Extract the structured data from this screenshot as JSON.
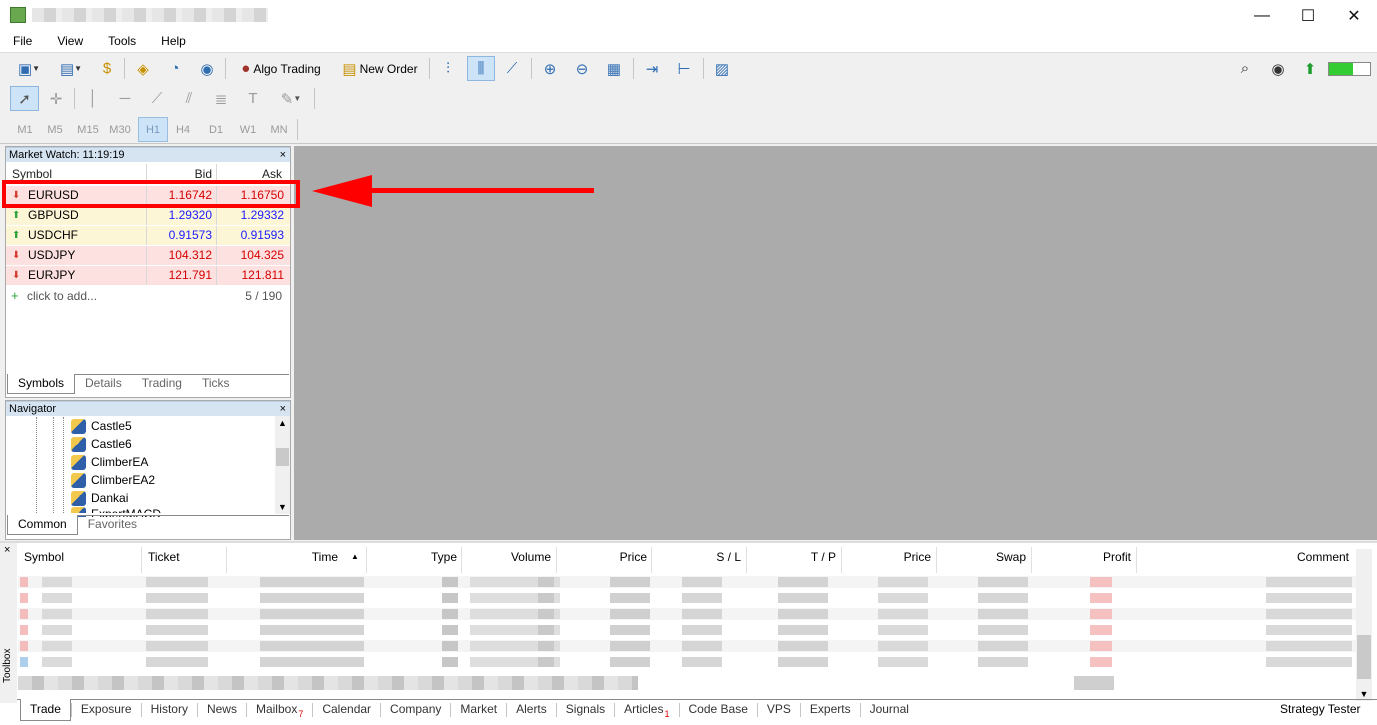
{
  "window": {
    "minimize_glyph": "—",
    "maximize_glyph": "☐",
    "close_glyph": "✕"
  },
  "menu": [
    "File",
    "View",
    "Tools",
    "Help"
  ],
  "toolbar": {
    "algo_trading": "Algo Trading",
    "new_order": "New Order"
  },
  "timeframes": [
    "M1",
    "M5",
    "M15",
    "M30",
    "H1",
    "H4",
    "D1",
    "W1",
    "MN"
  ],
  "selected_timeframe": "H1",
  "market_watch": {
    "title": "Market Watch: 11:19:19",
    "close": "×",
    "columns": {
      "symbol": "Symbol",
      "bid": "Bid",
      "ask": "Ask"
    },
    "rows": [
      {
        "symbol": "EURUSD",
        "bid": "1.16742",
        "ask": "1.16750",
        "direction": "down"
      },
      {
        "symbol": "GBPUSD",
        "bid": "1.29320",
        "ask": "1.29332",
        "direction": "up"
      },
      {
        "symbol": "USDCHF",
        "bid": "0.91573",
        "ask": "0.91593",
        "direction": "up"
      },
      {
        "symbol": "USDJPY",
        "bid": "104.312",
        "ask": "104.325",
        "direction": "down"
      },
      {
        "symbol": "EURJPY",
        "bid": "121.791",
        "ask": "121.811",
        "direction": "down"
      }
    ],
    "add_text": "click to add...",
    "count": "5 / 190",
    "tabs": [
      "Symbols",
      "Details",
      "Trading",
      "Ticks"
    ]
  },
  "navigator": {
    "title": "Navigator",
    "close": "×",
    "items": [
      "Castle5",
      "Castle6",
      "ClimberEA",
      "ClimberEA2",
      "Dankai",
      "ExpertMACD"
    ],
    "tabs": [
      "Common",
      "Favorites"
    ]
  },
  "toolbox": {
    "label": "Toolbox",
    "close": "×",
    "columns": [
      "Symbol",
      "Ticket",
      "Time",
      "Type",
      "Volume",
      "Price",
      "S / L",
      "T / P",
      "Price",
      "Swap",
      "Profit",
      "Comment"
    ],
    "sort_glyph": "▲",
    "tabs": [
      {
        "label": "Trade"
      },
      {
        "label": "Exposure"
      },
      {
        "label": "History"
      },
      {
        "label": "News"
      },
      {
        "label": "Mailbox",
        "badge": "7"
      },
      {
        "label": "Calendar"
      },
      {
        "label": "Company"
      },
      {
        "label": "Market"
      },
      {
        "label": "Alerts"
      },
      {
        "label": "Signals"
      },
      {
        "label": "Articles",
        "badge": "1"
      },
      {
        "label": "Code Base"
      },
      {
        "label": "VPS"
      },
      {
        "label": "Experts"
      },
      {
        "label": "Journal"
      }
    ],
    "strategy_tester": "Strategy Tester"
  },
  "colors": {
    "highlight": "#ff0000",
    "bid_up": "#1a1aff",
    "price_down": "#d40000",
    "row_down_bg": "#fde0e0",
    "row_up_bg": "#fdf6d6",
    "chart_bg": "#ababab"
  }
}
